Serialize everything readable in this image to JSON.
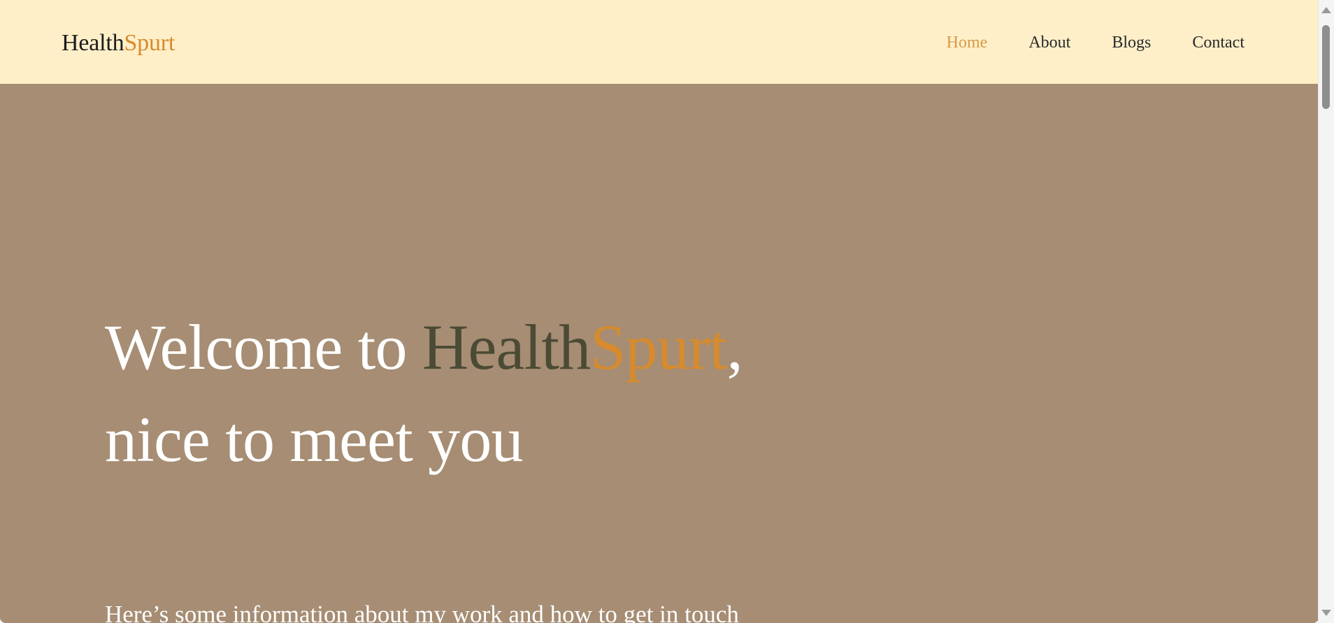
{
  "header": {
    "logo": {
      "part1": "Health",
      "part2": "Spurt"
    },
    "nav": [
      {
        "label": "Home",
        "active": true
      },
      {
        "label": "About",
        "active": false
      },
      {
        "label": "Blogs",
        "active": false
      },
      {
        "label": "Contact",
        "active": false
      }
    ]
  },
  "hero": {
    "title_line1_prefix": "Welcome to ",
    "title_brand_part1": "Health",
    "title_brand_part2": "Spurt",
    "title_line1_suffix": ",",
    "title_line2": "nice to meet you",
    "subtitle": "Here’s some information about my work and how to get in touch"
  },
  "colors": {
    "header_bg": "#ffefc9",
    "hero_bg": "#a68d73",
    "brand_accent": "#d78b2e",
    "brand_dark": "#4b4b35",
    "nav_active": "#d79a44"
  },
  "icons": {
    "scroll_up": "scroll-up-arrow-icon",
    "scroll_down": "scroll-down-arrow-icon"
  }
}
